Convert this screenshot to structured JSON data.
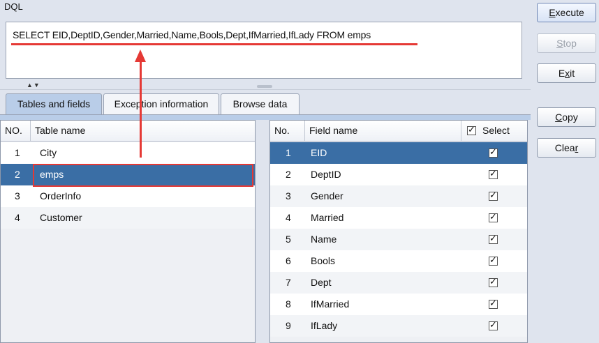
{
  "editor": {
    "label": "DQL",
    "sql": "SELECT EID,DeptID,Gender,Married,Name,Bools,Dept,IfMarried,IfLady FROM emps"
  },
  "buttons": {
    "execute": {
      "pre": "",
      "mnemonic": "E",
      "post": "xecute"
    },
    "stop": {
      "pre": "",
      "mnemonic": "S",
      "post": "top"
    },
    "exit": {
      "pre": "E",
      "mnemonic": "x",
      "post": "it"
    },
    "copy": {
      "pre": "",
      "mnemonic": "C",
      "post": "opy"
    },
    "clear": {
      "pre": "Clea",
      "mnemonic": "r",
      "post": ""
    }
  },
  "tabs": [
    "Tables and fields",
    "Exception information",
    "Browse data"
  ],
  "tables": {
    "headers": {
      "no": "NO.",
      "name": "Table name"
    },
    "rows": [
      {
        "no": "1",
        "name": "City"
      },
      {
        "no": "2",
        "name": "emps"
      },
      {
        "no": "3",
        "name": "OrderInfo"
      },
      {
        "no": "4",
        "name": "Customer"
      }
    ]
  },
  "fields": {
    "headers": {
      "no": "No.",
      "name": "Field name",
      "select": "Select"
    },
    "rows": [
      {
        "no": "1",
        "name": "EID",
        "checked": true
      },
      {
        "no": "2",
        "name": "DeptID",
        "checked": true
      },
      {
        "no": "3",
        "name": "Gender",
        "checked": true
      },
      {
        "no": "4",
        "name": "Married",
        "checked": true
      },
      {
        "no": "5",
        "name": "Name",
        "checked": true
      },
      {
        "no": "6",
        "name": "Bools",
        "checked": true
      },
      {
        "no": "7",
        "name": "Dept",
        "checked": true
      },
      {
        "no": "8",
        "name": "IfMarried",
        "checked": true
      },
      {
        "no": "9",
        "name": "IfLady",
        "checked": true
      }
    ]
  },
  "colors": {
    "selection": "#3a6ea5",
    "annotation": "#e53935"
  }
}
